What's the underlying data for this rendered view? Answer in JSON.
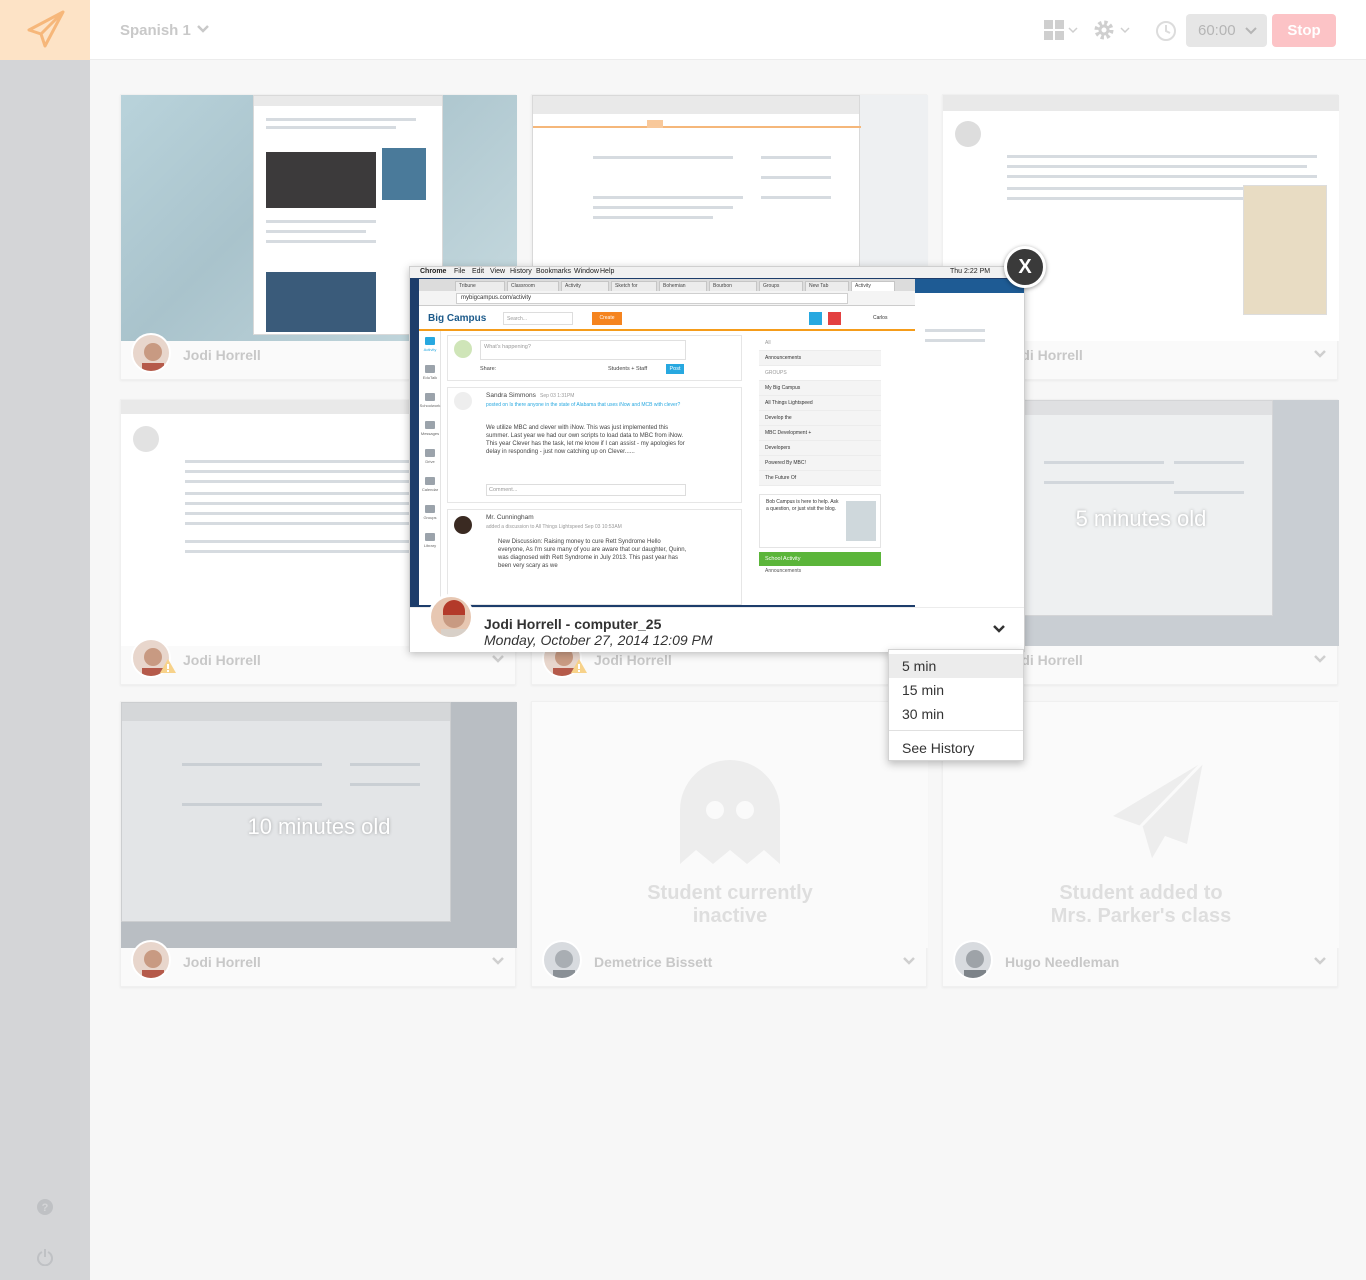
{
  "topbar": {
    "class_name": "Spanish 1",
    "timer_value": "60:00",
    "stop_label": "Stop"
  },
  "tiles": [
    {
      "student": "Jodi Horrell",
      "age_label": ""
    },
    {
      "student": "",
      "age_label": ""
    },
    {
      "student": "Jodi Horrell",
      "age_label": ""
    },
    {
      "student": "Jodi Horrell",
      "age_label": ""
    },
    {
      "student": "Jodi Horrell",
      "age_label": ""
    },
    {
      "student": "Jodi Horrell",
      "age_label": "5 minutes old"
    },
    {
      "student": "Jodi Horrell",
      "age_label": "10 minutes old"
    },
    {
      "student": "Demetrice Bissett",
      "status": "Student currently inactive"
    },
    {
      "student": "Hugo Needleman",
      "status": "Student added to Mrs. Parker's class"
    }
  ],
  "status_lines": {
    "inactive_1": "Student currently",
    "inactive_2": "inactive",
    "added_1": "Student added to",
    "added_2": "Mrs. Parker's class"
  },
  "preview": {
    "title": "Jodi Horrell - computer_25",
    "timestamp": "Monday, October 27, 2014 12:09 PM",
    "close_label": "X",
    "mac_menu": [
      "Chrome",
      "File",
      "Edit",
      "View",
      "History",
      "Bookmarks",
      "Window",
      "Help"
    ],
    "mac_clock": "Thu 2:22 PM",
    "browser": {
      "tabs": [
        "Tribune",
        "Classroom",
        "Activity",
        "Sketch for",
        "Bohemian",
        "Bourbon",
        "Groups",
        "New Tab",
        "Activity"
      ],
      "url": "mybigcampus.com/activity",
      "logo": "Big Campus",
      "search_placeholder": "Search...",
      "create_label": "Create",
      "user": "Carlos",
      "nav": [
        "Activity",
        "EduTalk",
        "Schoolwork",
        "Messages",
        "Drive",
        "Calendar",
        "Groups",
        "Library"
      ],
      "compose_placeholder": "What's happening?",
      "share_label": "Share:",
      "audience": "Students + Staff",
      "post_label": "Post",
      "post1_author": "Sandra Simmons",
      "post1_time": "Sep 03 1:31PM",
      "post1_context": "posted on Is there anyone in the state of Alabama that uses iNow and MCB with clever?",
      "post1_body": "We utilize MBC and clever with iNow. This was just implemented this summer. Last year we had our own scripts to load data to MBC from iNow. This year Clever has the task, let me know if I can assist - my apologies for delay in responding - just now catching up on Clever......",
      "comment_placeholder": "Comment...",
      "post2_author": "Mr. Cunningham",
      "post2_context": "added a discussion to All Things Lightspeed Sep 03 10:53AM",
      "post2_body": "New Discussion: Raising money to cure Rett Syndrome Hello everyone, As I'm sure many of you are aware that our daughter, Quinn, was diagnosed with Rett Syndrome in July 2013. This past year has been very scary as we",
      "groups": [
        "All",
        "Announcements",
        "GROUPS",
        "My Big Campus",
        "All Things Lightspeed",
        "Develop the",
        "MBC Development +",
        "Developers",
        "Powered By MBC!",
        "The Future Of"
      ],
      "bob_text": "Bob Campus is here to help. Ask a question, or just visit the blog.",
      "school_activity": "School Activity",
      "announcements": "Announcements"
    }
  },
  "dropdown": {
    "items": [
      "5 min",
      "15 min",
      "30 min"
    ],
    "history": "See History"
  },
  "colors": {
    "accent_orange": "#f5841f",
    "stop_red": "#fcc3c6",
    "logo_bg": "#fde3c6"
  }
}
